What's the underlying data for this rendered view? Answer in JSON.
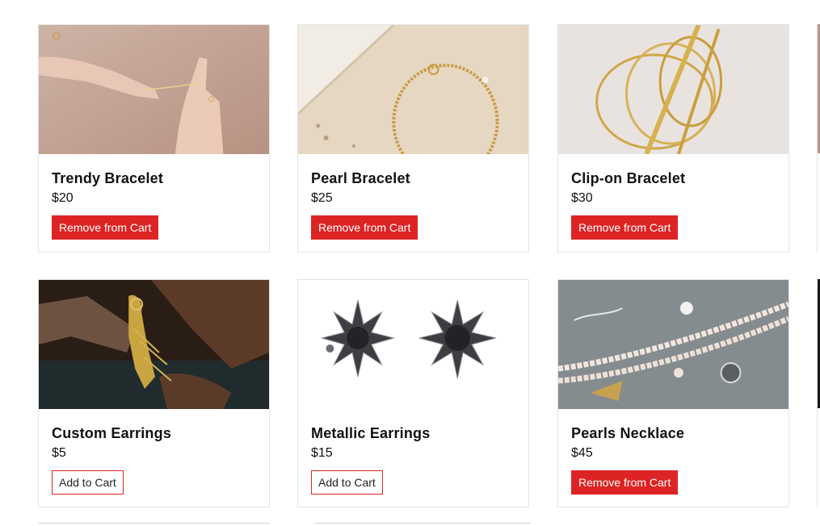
{
  "products": [
    {
      "name": "Trendy Bracelet",
      "price": "$20",
      "button": "Remove from Cart",
      "in_cart": true,
      "image_icon": "hands-bracelet-photo"
    },
    {
      "name": "Pearl Bracelet",
      "price": "$25",
      "button": "Remove from Cart",
      "in_cart": true,
      "image_icon": "gold-chain-bracelet-photo"
    },
    {
      "name": "Clip-on Bracelet",
      "price": "$30",
      "button": "Remove from Cart",
      "in_cart": true,
      "image_icon": "gold-cuff-bracelets-photo"
    },
    {
      "name": "Custom Earrings",
      "price": "$5",
      "button": "Add to Cart",
      "in_cart": false,
      "image_icon": "jeweler-hands-earring-photo"
    },
    {
      "name": "Metallic Earrings",
      "price": "$15",
      "button": "Add to Cart",
      "in_cart": false,
      "image_icon": "star-earrings-photo"
    },
    {
      "name": "Pearls Necklace",
      "price": "$45",
      "button": "Remove from Cart",
      "in_cart": true,
      "image_icon": "pearl-necklace-photo"
    }
  ],
  "colors": {
    "accent": "#dd2424",
    "border": "#e4e4e4",
    "text": "#111111"
  }
}
